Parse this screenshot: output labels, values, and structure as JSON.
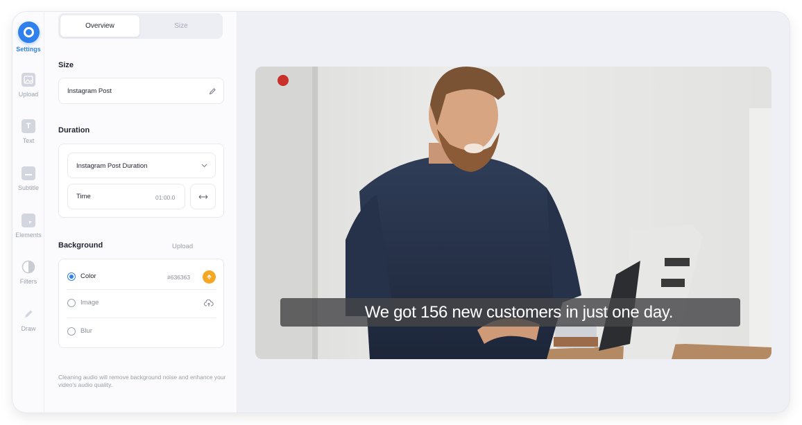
{
  "rail": {
    "items": [
      {
        "label": "Settings",
        "icon": "settings-icon",
        "active": true
      },
      {
        "label": "Upload",
        "icon": "image-icon"
      },
      {
        "label": "Text",
        "icon": "text-icon",
        "glyph": "T"
      },
      {
        "label": "Subtitle",
        "icon": "subtitle-icon"
      },
      {
        "label": "Elements",
        "icon": "elements-icon"
      },
      {
        "label": "Filters",
        "icon": "filters-icon"
      },
      {
        "label": "Draw",
        "icon": "pen-icon"
      }
    ]
  },
  "tabs": {
    "overview": "Overview",
    "size": "Size"
  },
  "size": {
    "title": "Size",
    "value": "Instagram Post"
  },
  "duration": {
    "title": "Duration",
    "select_value": "Instagram Post Duration",
    "time_label": "Time",
    "time_value": "01:00.0"
  },
  "background": {
    "title": "Background",
    "upload_label": "Upload",
    "options": {
      "color": {
        "label": "Color",
        "value": "#636363",
        "selected": true
      },
      "image": {
        "label": "Image"
      },
      "blur": {
        "label": "Blur"
      }
    }
  },
  "note": "Cleaning audio will remove background noise and enhance your video's audio quality.",
  "preview": {
    "caption": "We got 156 new customers in just one day."
  },
  "colors": {
    "accent": "#2f80ed",
    "swatch_button": "#f5a623"
  }
}
